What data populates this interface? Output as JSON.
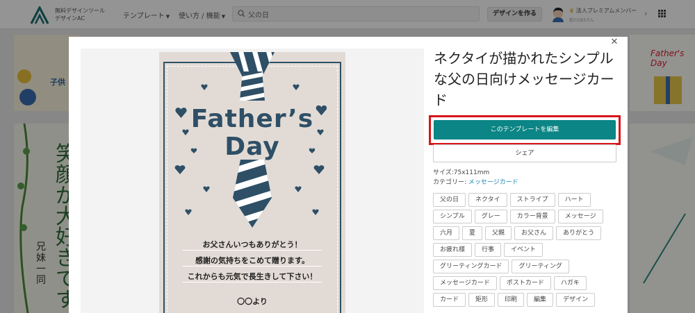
{
  "header": {
    "logo_line1": "無料デザインツール",
    "logo_line2": "デザインAC",
    "nav": [
      {
        "label": "テンプレート"
      },
      {
        "label": "使い方 / 機能"
      }
    ],
    "search_value": "父の日",
    "make_design_label": "デザインを作る",
    "user_plan": "法人プレミアムメンバー",
    "user_name": "前川1B3さん"
  },
  "background": {
    "left_vertical_text": "笑顔が大好きです",
    "left_small_text": "兄妹一同",
    "top_left_text": "子供",
    "right_card_text": "Father's Day"
  },
  "modal": {
    "title": "ネクタイが描かれたシンプルな父の日向けメッセージカード",
    "edit_label": "このテンプレートを編集",
    "share_label": "シェア",
    "size_label": "サイズ:75x111mm",
    "category_prefix": "カテゴリー: ",
    "category_link": "メッセージカード",
    "tags": [
      "父の日",
      "ネクタイ",
      "ストライプ",
      "ハート",
      "シンプル",
      "グレー",
      "カラー背景",
      "メッセージ",
      "六月",
      "夏",
      "父親",
      "お父さん",
      "ありがとう",
      "お疲れ様",
      "行事",
      "イベント",
      "グリーティングカード",
      "グリーティング",
      "メッセージカード",
      "ポストカード",
      "ハガキ",
      "カード",
      "矩形",
      "印刷",
      "編集",
      "デザイン"
    ],
    "card": {
      "heading_1": "Father’s",
      "heading_2": "Day",
      "message_1": "お父さんいつもありがとう！",
      "message_2": "感謝の気持ちをこめて贈ります。",
      "message_3": "これからも元気で長生きして下さい！",
      "signature": "〇〇より"
    }
  },
  "colors": {
    "accent": "#0b8585",
    "highlight": "#d7141a",
    "card_bg": "#e2dbd5",
    "navy": "#2e4f66"
  }
}
